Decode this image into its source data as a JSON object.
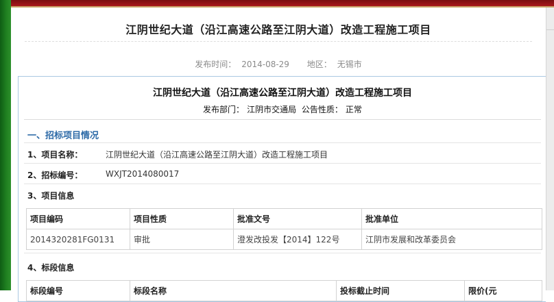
{
  "header": {
    "page_title": "江阴世纪大道（沿江高速公路至江阴大道）改造工程施工项目",
    "publish_time_label": "发布时间：",
    "publish_time": "2014-08-29",
    "region_label": "地区：",
    "region": "无锡市"
  },
  "document": {
    "title": "江阴世纪大道（沿江高速公路至江阴大道）改造工程施工项目",
    "department_label": "发布部门：",
    "department": "江阴市交通局",
    "nature_label": "公告性质：",
    "nature": "正常"
  },
  "section1": {
    "heading": "一、招标项目情况",
    "project_name_label": "1、项目名称：",
    "project_name": "江阴世纪大道（沿江高速公路至江阴大道）改造工程施工项目",
    "bid_number_label": "2、招标编号：",
    "bid_number": "WXJT2014080017",
    "project_info_label": "3、项目信息",
    "project_table": {
      "headers": [
        "项目编码",
        "项目性质",
        "批准文号",
        "批准单位"
      ],
      "rows": [
        [
          "2014320281FG0131",
          "审批",
          "澄发改投发【2014】122号",
          "江阴市发展和改革委员会"
        ]
      ]
    },
    "section_info_label": "4、标段信息",
    "section_table": {
      "headers": [
        "标段编号",
        "标段名称",
        "投标截止时间",
        "限价(元"
      ]
    }
  },
  "colors": {
    "left_bar": "#1f7f20",
    "top_banner": "#9c1518",
    "section_heading": "#2d6aa7",
    "box_border": "#a9c8e2"
  }
}
